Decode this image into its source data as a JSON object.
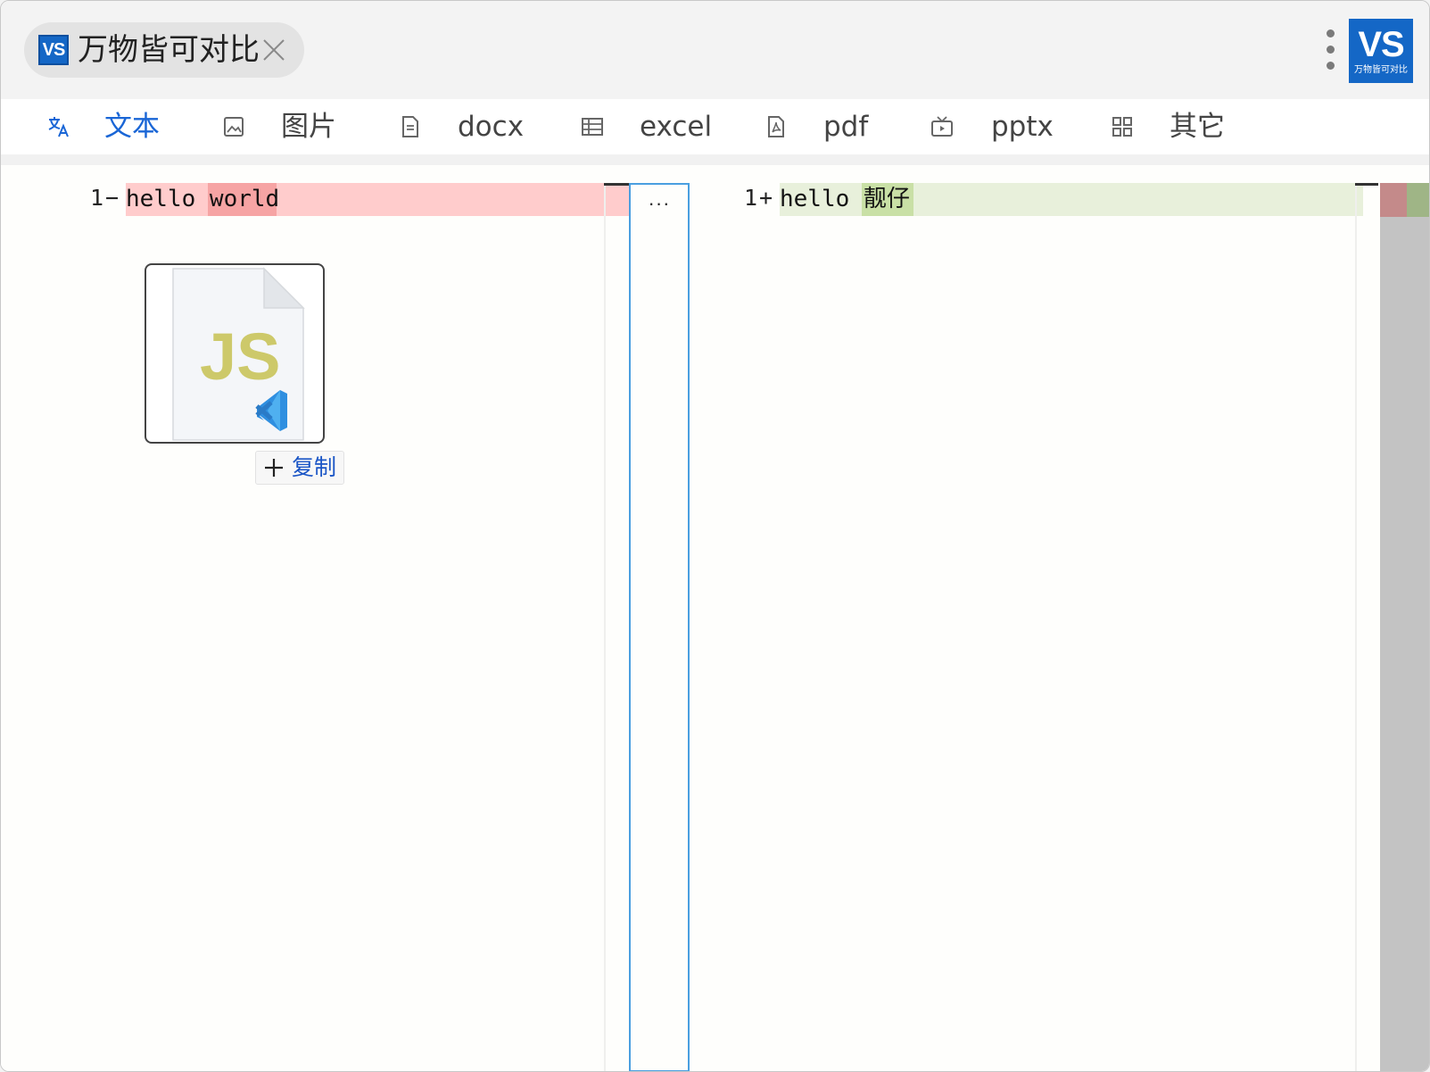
{
  "titlebar": {
    "tab_logo_text": "VS",
    "tab_title": "万物皆可对比",
    "app_logo_big": "VS",
    "app_logo_small": "万物皆可对比"
  },
  "toolbar": {
    "tools": [
      {
        "label": "文本",
        "icon": "translate-icon",
        "active": true
      },
      {
        "label": "图片",
        "icon": "image-icon",
        "active": false
      },
      {
        "label": "docx",
        "icon": "document-icon",
        "active": false
      },
      {
        "label": "excel",
        "icon": "table-icon",
        "active": false
      },
      {
        "label": "pdf",
        "icon": "pdf-icon",
        "active": false
      },
      {
        "label": "pptx",
        "icon": "tv-icon",
        "active": false
      },
      {
        "label": "其它",
        "icon": "grid-icon",
        "active": false
      }
    ]
  },
  "diff": {
    "left": {
      "line_number": "1",
      "marker": "−",
      "text_plain": "hello ",
      "text_changed": "world"
    },
    "right": {
      "line_number": "1",
      "marker": "+",
      "text_plain": "hello ",
      "text_changed": "靓仔"
    },
    "middle_dots": "···"
  },
  "file_card": {
    "badge_text": "JS",
    "copy_label": "复制"
  },
  "colors": {
    "accent": "#1a66d6",
    "deleted_line": "#ffcccc",
    "deleted_word": "#f6a4a4",
    "inserted_line": "#e8f0db",
    "inserted_word": "#c9e0a6",
    "logo_blue": "#1467c6"
  }
}
